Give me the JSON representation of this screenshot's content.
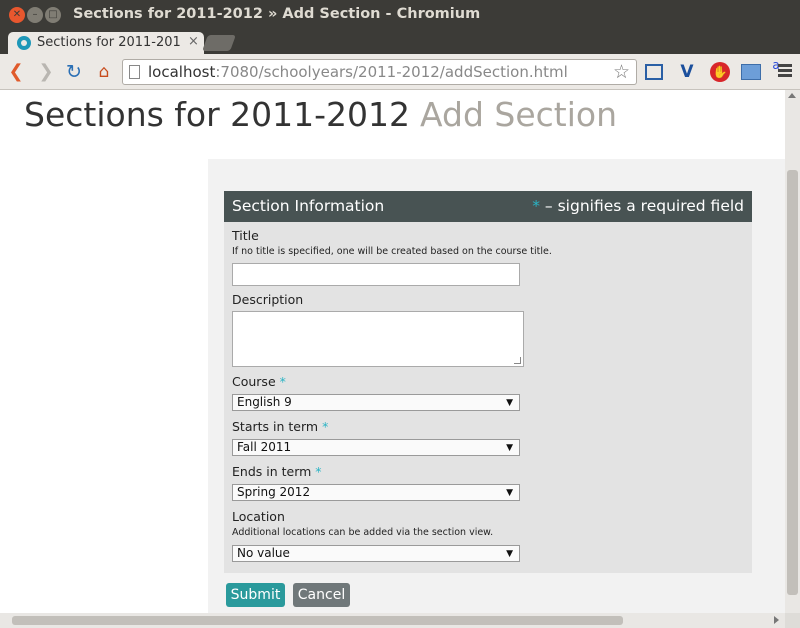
{
  "window": {
    "title": "Sections for 2011-2012 » Add Section - Chromium",
    "close_glyph": "✕",
    "min_glyph": "–",
    "max_glyph": "□"
  },
  "tab": {
    "label": "Sections for 2011-201",
    "close_glyph": "×"
  },
  "toolbar": {
    "back_glyph": "❮",
    "forward_glyph": "❯",
    "reload_glyph": "↻",
    "home_glyph": "⌂",
    "url_host": "localhost",
    "url_rest": ":7080/schoolyears/2011-2012/addSection.html",
    "star_glyph": "☆",
    "ext_v_glyph": "V",
    "ext_stop_glyph": "✋",
    "ext_a_glyph": "a"
  },
  "page": {
    "heading": "Sections for 2011-2012",
    "subheading": "Add Section"
  },
  "form": {
    "header_title": "Section Information",
    "required_star": "*",
    "required_note": " – signifies a required field",
    "title_label": "Title",
    "title_hint": "If no title is specified, one will be created based on the course title.",
    "title_value": "",
    "description_label": "Description",
    "description_value": "",
    "course_label": "Course",
    "course_value": "English 9",
    "starts_label": "Starts in term",
    "starts_value": "Fall 2011",
    "ends_label": "Ends in term",
    "ends_value": "Spring 2012",
    "location_label": "Location",
    "location_hint": "Additional locations can be added via the section view.",
    "location_value": "No value",
    "dropdown_arrow": "▼",
    "submit_label": "Submit",
    "cancel_label": "Cancel"
  },
  "colors": {
    "header_bg": "#485353",
    "required_accent": "#2ab3c4",
    "submit_bg": "#2a9a9c",
    "cancel_bg": "#70787a"
  }
}
